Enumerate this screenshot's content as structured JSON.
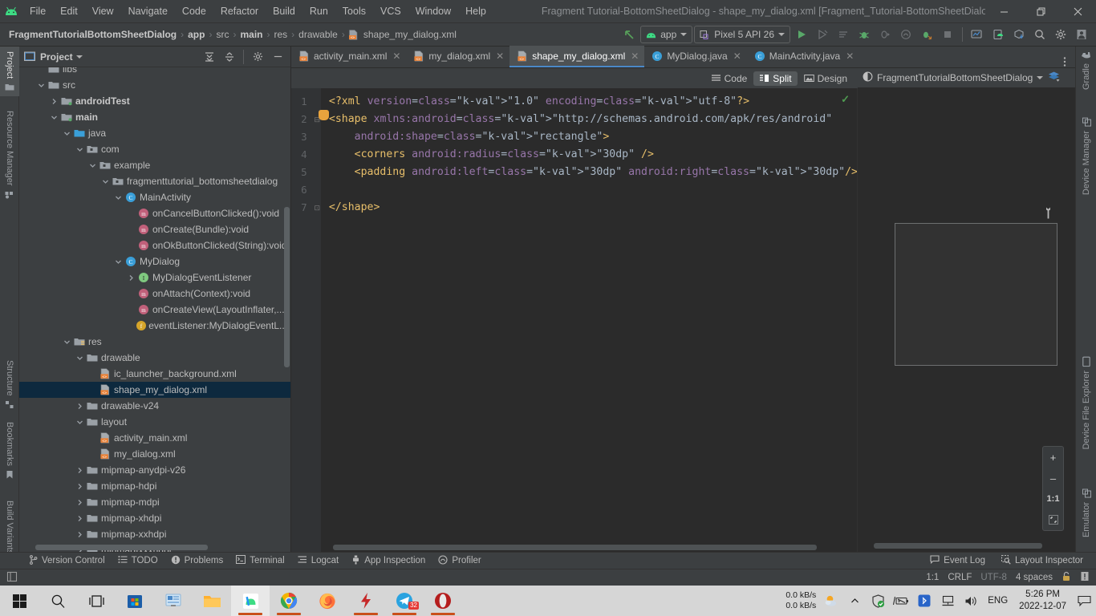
{
  "window": {
    "title": "Fragment Tutorial-BottomSheetDialog - shape_my_dialog.xml [Fragment_Tutorial-BottomSheetDialog.app.main]",
    "minimize": "—",
    "restore": "❐",
    "close": "✕"
  },
  "menu": {
    "items": [
      {
        "label": "File"
      },
      {
        "label": "Edit"
      },
      {
        "label": "View"
      },
      {
        "label": "Navigate"
      },
      {
        "label": "Code"
      },
      {
        "label": "Refactor"
      },
      {
        "label": "Build"
      },
      {
        "label": "Run"
      },
      {
        "label": "Tools"
      },
      {
        "label": "VCS"
      },
      {
        "label": "Window"
      },
      {
        "label": "Help"
      }
    ]
  },
  "breadcrumb": {
    "items": [
      {
        "label": "FragmentTutorialBottomSheetDialog",
        "bold": true
      },
      {
        "label": "app",
        "bold": true
      },
      {
        "label": "src",
        "bold": false
      },
      {
        "label": "main",
        "bold": true
      },
      {
        "label": "res",
        "bold": false
      },
      {
        "label": "drawable",
        "bold": false
      },
      {
        "label": "shape_my_dialog.xml",
        "bold": false
      }
    ],
    "separator": "›"
  },
  "toolbar": {
    "module_selector": "app",
    "device_selector": "Pixel 5 API 26",
    "run_label": "Run",
    "debug_label": "Debug",
    "stop_label": "Stop",
    "search_label": "Search Everywhere",
    "settings_label": "Settings",
    "avatar_label": "Account"
  },
  "left_tool_window": {
    "tabs": [
      {
        "label": "Project",
        "selected": true
      },
      {
        "label": "Resource Manager",
        "selected": false
      },
      {
        "label": "Structure",
        "selected": false
      },
      {
        "label": "Bookmarks",
        "selected": false
      },
      {
        "label": "Build Variants",
        "selected": false
      }
    ]
  },
  "right_tool_window": {
    "tabs": [
      {
        "label": "Gradle"
      },
      {
        "label": "Device Manager"
      },
      {
        "label": "Device File Explorer"
      },
      {
        "label": "Emulator"
      }
    ]
  },
  "project_panel": {
    "title": "Project",
    "tree": [
      {
        "label": "libs",
        "indent": 2,
        "twist": "",
        "icon": "folder",
        "bold": false,
        "selected": false,
        "clipped": true
      },
      {
        "label": "src",
        "indent": 2,
        "twist": "down",
        "icon": "folder",
        "bold": false,
        "selected": false
      },
      {
        "label": "androidTest",
        "indent": 3,
        "twist": "right",
        "icon": "folder-src",
        "bold": true,
        "selected": false
      },
      {
        "label": "main",
        "indent": 3,
        "twist": "down",
        "icon": "folder-src",
        "bold": true,
        "selected": false
      },
      {
        "label": "java",
        "indent": 4,
        "twist": "down",
        "icon": "folder-java",
        "bold": false,
        "selected": false
      },
      {
        "label": "com",
        "indent": 5,
        "twist": "down",
        "icon": "package",
        "bold": false,
        "selected": false
      },
      {
        "label": "example",
        "indent": 6,
        "twist": "down",
        "icon": "package",
        "bold": false,
        "selected": false
      },
      {
        "label": "fragmenttutorial_bottomsheetdialog",
        "indent": 7,
        "twist": "down",
        "icon": "package",
        "bold": false,
        "selected": false
      },
      {
        "label": "MainActivity",
        "indent": 8,
        "twist": "down",
        "icon": "class",
        "bold": false,
        "selected": false
      },
      {
        "label": "onCancelButtonClicked():void",
        "indent": 9,
        "twist": "",
        "icon": "method",
        "bold": false,
        "selected": false
      },
      {
        "label": "onCreate(Bundle):void",
        "indent": 9,
        "twist": "",
        "icon": "method",
        "bold": false,
        "selected": false
      },
      {
        "label": "onOkButtonClicked(String):void",
        "indent": 9,
        "twist": "",
        "icon": "method",
        "bold": false,
        "selected": false
      },
      {
        "label": "MyDialog",
        "indent": 8,
        "twist": "down",
        "icon": "class",
        "bold": false,
        "selected": false
      },
      {
        "label": "MyDialogEventListener",
        "indent": 9,
        "twist": "right",
        "icon": "interface",
        "bold": false,
        "selected": false
      },
      {
        "label": "onAttach(Context):void",
        "indent": 9,
        "twist": "",
        "icon": "method",
        "bold": false,
        "selected": false
      },
      {
        "label": "onCreateView(LayoutInflater,...",
        "indent": 9,
        "twist": "",
        "icon": "method",
        "bold": false,
        "selected": false
      },
      {
        "label": "eventListener:MyDialogEventL...",
        "indent": 9,
        "twist": "",
        "icon": "field",
        "bold": false,
        "selected": false
      },
      {
        "label": "res",
        "indent": 4,
        "twist": "down",
        "icon": "folder-res",
        "bold": false,
        "selected": false
      },
      {
        "label": "drawable",
        "indent": 5,
        "twist": "down",
        "icon": "folder",
        "bold": false,
        "selected": false
      },
      {
        "label": "ic_launcher_background.xml",
        "indent": 6,
        "twist": "",
        "icon": "xml",
        "bold": false,
        "selected": false
      },
      {
        "label": "shape_my_dialog.xml",
        "indent": 6,
        "twist": "",
        "icon": "xml",
        "bold": false,
        "selected": true
      },
      {
        "label": "drawable-v24",
        "indent": 5,
        "twist": "right",
        "icon": "folder",
        "bold": false,
        "selected": false
      },
      {
        "label": "layout",
        "indent": 5,
        "twist": "down",
        "icon": "folder",
        "bold": false,
        "selected": false
      },
      {
        "label": "activity_main.xml",
        "indent": 6,
        "twist": "",
        "icon": "xml",
        "bold": false,
        "selected": false
      },
      {
        "label": "my_dialog.xml",
        "indent": 6,
        "twist": "",
        "icon": "xml",
        "bold": false,
        "selected": false
      },
      {
        "label": "mipmap-anydpi-v26",
        "indent": 5,
        "twist": "right",
        "icon": "folder",
        "bold": false,
        "selected": false
      },
      {
        "label": "mipmap-hdpi",
        "indent": 5,
        "twist": "right",
        "icon": "folder",
        "bold": false,
        "selected": false
      },
      {
        "label": "mipmap-mdpi",
        "indent": 5,
        "twist": "right",
        "icon": "folder",
        "bold": false,
        "selected": false
      },
      {
        "label": "mipmap-xhdpi",
        "indent": 5,
        "twist": "right",
        "icon": "folder",
        "bold": false,
        "selected": false
      },
      {
        "label": "mipmap-xxhdpi",
        "indent": 5,
        "twist": "right",
        "icon": "folder",
        "bold": false,
        "selected": false
      },
      {
        "label": "mipmap-xxxhdpi",
        "indent": 5,
        "twist": "right",
        "icon": "folder",
        "bold": false,
        "selected": false,
        "clipped": true
      }
    ]
  },
  "editor_tabs": [
    {
      "label": "activity_main.xml",
      "icon": "xml",
      "active": false
    },
    {
      "label": "my_dialog.xml",
      "icon": "xml",
      "active": false
    },
    {
      "label": "shape_my_dialog.xml",
      "icon": "xml",
      "active": true
    },
    {
      "label": "MyDialog.java",
      "icon": "class",
      "active": false
    },
    {
      "label": "MainActivity.java",
      "icon": "class",
      "active": false
    }
  ],
  "view_modes": [
    {
      "label": "Code",
      "selected": false
    },
    {
      "label": "Split",
      "selected": true
    },
    {
      "label": "Design",
      "selected": false
    }
  ],
  "editor": {
    "line_numbers": [
      "1",
      "2",
      "3",
      "4",
      "5",
      "6",
      "7"
    ],
    "lines": [
      {
        "num": "1",
        "text": "<?xml version=\"1.0\" encoding=\"utf-8\"?>"
      },
      {
        "num": "2",
        "text": "<shape xmlns:android=\"http://schemas.android.com/apk/res/android\""
      },
      {
        "num": "3",
        "text": "    android:shape=\"rectangle\">"
      },
      {
        "num": "4",
        "text": "    <corners android:radius=\"30dp\" />"
      },
      {
        "num": "5",
        "text": "    <padding android:left=\"30dp\" android:right=\"30dp\"/>"
      },
      {
        "num": "6",
        "text": ""
      },
      {
        "num": "7",
        "text": "</shape>"
      }
    ],
    "inspection_status": "✓"
  },
  "preview": {
    "theme_name": "FragmentTutorialBottomSheetDialog",
    "zoom_in": "+",
    "zoom_out": "–",
    "zoom_actual": "1:1",
    "zoom_fit": "⛶"
  },
  "bottom_tools": [
    {
      "label": "Version Control",
      "icon": "branch-icon"
    },
    {
      "label": "TODO",
      "icon": "list-icon"
    },
    {
      "label": "Problems",
      "icon": "warning-icon"
    },
    {
      "label": "Terminal",
      "icon": "terminal-icon"
    },
    {
      "label": "Logcat",
      "icon": "logcat-icon"
    },
    {
      "label": "App Inspection",
      "icon": "inspect-icon"
    },
    {
      "label": "Profiler",
      "icon": "profiler-icon"
    }
  ],
  "bottom_tools_right": [
    {
      "label": "Event Log",
      "icon": "event-log-icon"
    },
    {
      "label": "Layout Inspector",
      "icon": "layout-inspector-icon"
    }
  ],
  "status_bar": {
    "caret_position": "1:1",
    "line_separator": "CRLF",
    "encoding": "UTF-8",
    "indent": "4 spaces",
    "lock_label": "Read-only toggle",
    "notify_label": "Notifications"
  },
  "taskbar": {
    "apps": [
      {
        "name": "start-button",
        "icon": "windows-logo",
        "running": false,
        "active": false
      },
      {
        "name": "search-button",
        "icon": "magnifier",
        "running": false,
        "active": false
      },
      {
        "name": "task-view-button",
        "icon": "task-view",
        "running": false,
        "active": false
      },
      {
        "name": "microsoft-store",
        "icon": "store",
        "running": false,
        "active": false
      },
      {
        "name": "powerpoint",
        "icon": "powerpoint",
        "running": false,
        "active": false
      },
      {
        "name": "file-explorer",
        "icon": "folder",
        "running": false,
        "active": false
      },
      {
        "name": "android-studio",
        "icon": "android-studio",
        "running": true,
        "active": true
      },
      {
        "name": "google-chrome",
        "icon": "chrome",
        "running": true,
        "active": false
      },
      {
        "name": "firefox",
        "icon": "firefox",
        "running": false,
        "active": false
      },
      {
        "name": "flash-app",
        "icon": "bolt",
        "running": true,
        "active": false
      },
      {
        "name": "telegram",
        "icon": "telegram",
        "running": true,
        "active": false,
        "badge": "32"
      },
      {
        "name": "opera",
        "icon": "opera",
        "running": true,
        "active": false
      }
    ],
    "network_up": "0.0 kB/s",
    "network_down": "0.0 kB/s",
    "language": "ENG",
    "time": "5:26 PM",
    "date": "2022-12-07",
    "weather_label": "Partly sunny"
  },
  "colors": {
    "accent_blue": "#4a88c7",
    "selection_blue": "#0d293e",
    "panel_bg": "#3c3f41",
    "editor_bg": "#2b2b2b",
    "xml_tag": "#e8bf6a",
    "xml_attr": "#9876aa",
    "xml_value": "#6a8759",
    "android_green": "#3ddc84"
  }
}
